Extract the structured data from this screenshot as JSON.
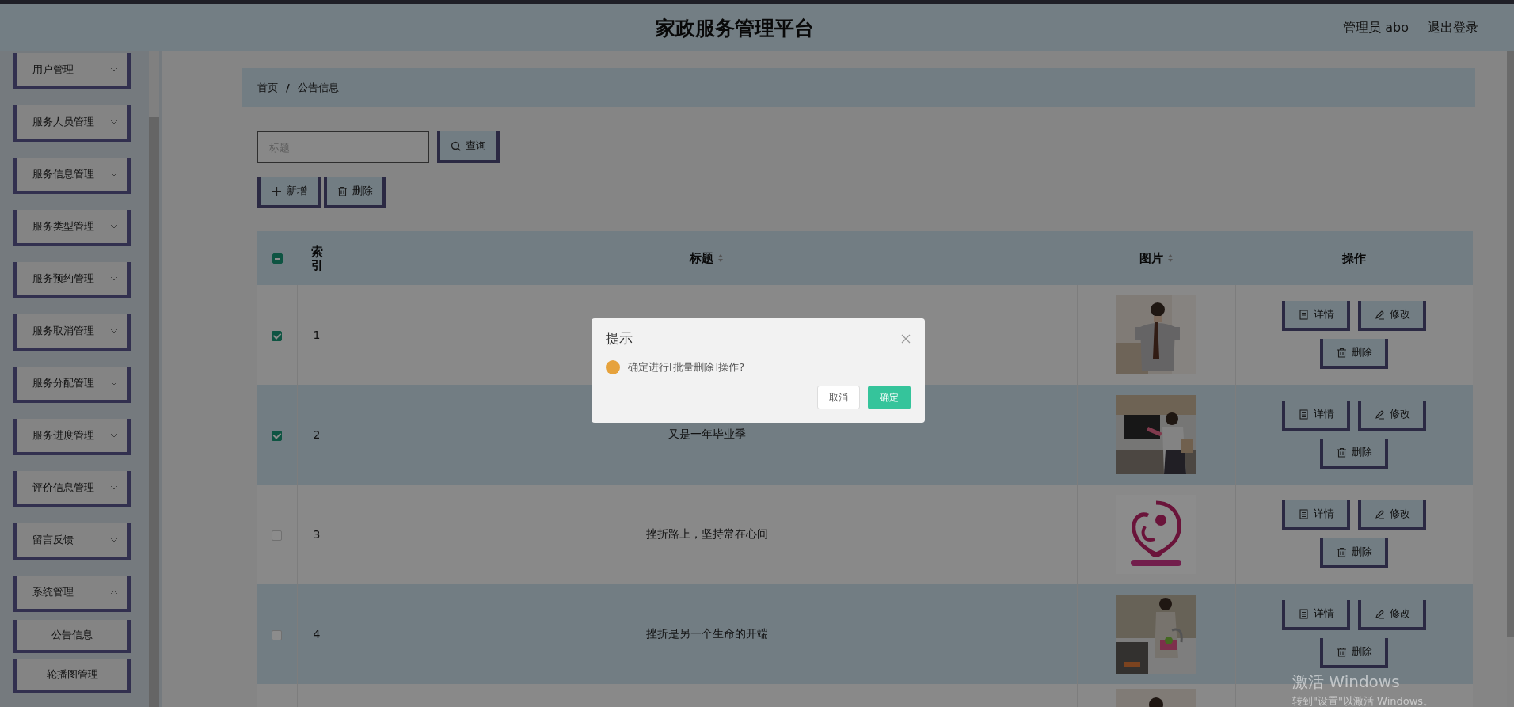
{
  "header": {
    "title": "家政服务管理平台",
    "user": "管理员 abo",
    "logout": "退出登录"
  },
  "sidebar": {
    "items": [
      {
        "label": "用户管理",
        "expanded": false
      },
      {
        "label": "服务人员管理",
        "expanded": false
      },
      {
        "label": "服务信息管理",
        "expanded": false
      },
      {
        "label": "服务类型管理",
        "expanded": false
      },
      {
        "label": "服务预约管理",
        "expanded": false
      },
      {
        "label": "服务取消管理",
        "expanded": false
      },
      {
        "label": "服务分配管理",
        "expanded": false
      },
      {
        "label": "服务进度管理",
        "expanded": false
      },
      {
        "label": "评价信息管理",
        "expanded": false
      },
      {
        "label": "留言反馈",
        "expanded": false
      },
      {
        "label": "系统管理",
        "expanded": true,
        "children": [
          {
            "label": "公告信息"
          },
          {
            "label": "轮播图管理"
          }
        ]
      }
    ]
  },
  "breadcrumb": {
    "items": [
      "首页",
      "公告信息"
    ],
    "separator": "/"
  },
  "search": {
    "placeholder": "标题",
    "button": "查询"
  },
  "toolbar": [
    {
      "label": "新增",
      "kind": "add"
    },
    {
      "label": "删除",
      "kind": "delete"
    }
  ],
  "table": {
    "header_checkbox": {
      "indeterminate": true
    },
    "columns": [
      {
        "label": "索引",
        "sortable": false
      },
      {
        "label": "标题",
        "sortable": true
      },
      {
        "label": "图片",
        "sortable": true
      },
      {
        "label": "操作",
        "sortable": false
      }
    ],
    "rows": [
      {
        "index": "1",
        "checked": true,
        "image": {
          "kind": "picture"
        },
        "actions": [
          {
            "label": "详情",
            "kind": "detail"
          },
          {
            "label": "修改",
            "kind": "edit"
          },
          {
            "label": "删除",
            "kind": "delete"
          }
        ]
      },
      {
        "index": "2",
        "checked": true,
        "title": "又是一年毕业季",
        "image": {
          "kind": "picture"
        },
        "actions": [
          {
            "label": "详情",
            "kind": "detail"
          },
          {
            "label": "修改",
            "kind": "edit"
          },
          {
            "label": "删除",
            "kind": "delete"
          }
        ]
      },
      {
        "index": "3",
        "checked": false,
        "title": "挫折路上，坚持常在心间",
        "image": {
          "kind": "picture"
        },
        "actions": [
          {
            "label": "详情",
            "kind": "detail"
          },
          {
            "label": "修改",
            "kind": "edit"
          },
          {
            "label": "删除",
            "kind": "delete"
          }
        ]
      },
      {
        "index": "4",
        "checked": false,
        "title": "挫折是另一个生命的开端",
        "image": {
          "kind": "picture"
        },
        "actions": [
          {
            "label": "详情",
            "kind": "detail"
          },
          {
            "label": "修改",
            "kind": "edit"
          },
          {
            "label": "删除",
            "kind": "delete"
          }
        ]
      },
      {
        "image": {
          "kind": "picture"
        }
      }
    ]
  },
  "dialog": {
    "title": "提示",
    "message": "确定进行[批量删除]操作?",
    "buttons": [
      {
        "label": "取消",
        "primary": false
      },
      {
        "label": "确定",
        "primary": true
      }
    ]
  },
  "os_notice": {
    "title": "激活 Windows",
    "text": "转到\"设置\"以激活 Windows。"
  }
}
